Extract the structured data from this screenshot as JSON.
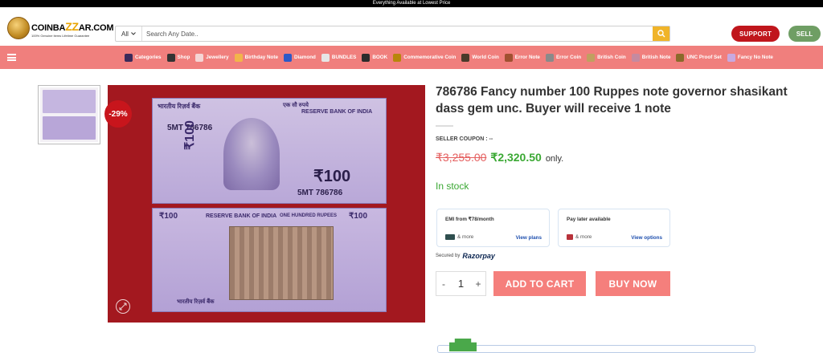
{
  "topbar": {
    "text": "Everything Available at Lowest Price"
  },
  "logo": {
    "word_left": "COINBA",
    "word_zz": "ZZ",
    "word_right": "AR.COM",
    "tagline": "100% Genuine items Lifetime Guarantee"
  },
  "search": {
    "category": "All",
    "placeholder": "Search Any Date.."
  },
  "header_buttons": {
    "support": "SUPPORT",
    "sell": "SELL"
  },
  "nav": {
    "items": [
      {
        "label": "Categories",
        "icon": "stack-icon",
        "color": "#3b2a5a"
      },
      {
        "label": "Shop",
        "icon": "bag-icon",
        "color": "#333333"
      },
      {
        "label": "Jewellery",
        "icon": "ring-icon",
        "color": "#f5d5d5"
      },
      {
        "label": "Birthday Note",
        "icon": "cake-icon",
        "color": "#f2b54a"
      },
      {
        "label": "Diamond",
        "icon": "diamond-icon",
        "color": "#2d59c7"
      },
      {
        "label": "BUNDLES",
        "icon": "bundle-icon",
        "color": "#e6e6e6"
      },
      {
        "label": "BOOK",
        "icon": "book-icon",
        "color": "#2b2b2b"
      },
      {
        "label": "Commemorative Coin",
        "icon": "coin-icon",
        "color": "#b8860b"
      },
      {
        "label": "World Coin",
        "icon": "globe-coin-icon",
        "color": "#4a3a2a"
      },
      {
        "label": "Error Note",
        "icon": "note-icon",
        "color": "#a05030"
      },
      {
        "label": "Error Coin",
        "icon": "coin-gray-icon",
        "color": "#8a8a8a"
      },
      {
        "label": "British Coin",
        "icon": "british-coin-icon",
        "color": "#c0a060"
      },
      {
        "label": "British Note",
        "icon": "british-note-icon",
        "color": "#c58aa0"
      },
      {
        "label": "UNC Proof Set",
        "icon": "proof-set-icon",
        "color": "#8a6a2a"
      },
      {
        "label": "Fancy No Note",
        "icon": "fancy-note-icon",
        "color": "#c8a9e0"
      }
    ]
  },
  "gallery": {
    "discount": "-29%",
    "front": {
      "gov": "भारतीय रिज़र्व बैंक",
      "rbi": "RESERVE BANK OF INDIA",
      "serial": "5MT 786786",
      "denom": "₹100",
      "hindi_amt": "एक सौ रुपये",
      "side_denom": "₹100"
    },
    "back": {
      "left_denom": "₹100",
      "rbi": "RESERVE BANK OF INDIA",
      "words": "ONE HUNDRED RUPEES",
      "right_denom": "₹100",
      "hindi_bottom": "भारतीय रिज़र्व बैंक"
    }
  },
  "product": {
    "title": "786786 Fancy number 100 Ruppes note governor shasikant dass gem unc. Buyer will receive 1 note",
    "seller_coupon": "SELLER COUPON : --",
    "price_old": "₹3,255.00",
    "price_new": "₹2,320.50",
    "price_suffix": "only.",
    "stock": "In stock"
  },
  "payment": {
    "emi": {
      "title": "EMI from ₹78/month",
      "more": "& more",
      "link": "View plans"
    },
    "paylater": {
      "title": "Pay later available",
      "more": "& more",
      "link": "View options"
    },
    "secured_by": "Secured by",
    "brand": "Razorpay"
  },
  "cart": {
    "minus": "-",
    "quantity": "1",
    "plus": "+",
    "add_to_cart": "ADD TO CART",
    "buy_now": "BUY NOW"
  },
  "colors": {
    "nav": "#f07f7d",
    "accent_button": "#f57f7c",
    "support": "#c0161c",
    "sell": "#6f9e64",
    "search_button": "#f0b429",
    "price_new": "#3aa833",
    "price_old": "#e56060"
  }
}
